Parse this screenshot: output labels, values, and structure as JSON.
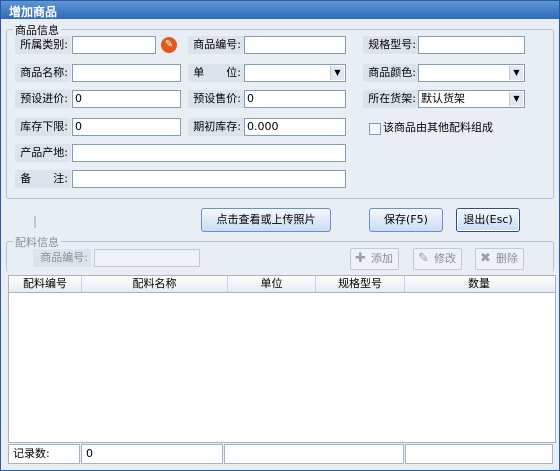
{
  "window": {
    "title": "增加商品"
  },
  "goods_info": {
    "legend": "商品信息",
    "category_label": "所属类别:",
    "category_value": "",
    "code_label": "商品编号:",
    "code_value": "",
    "spec_label": "规格型号:",
    "spec_value": "",
    "name_label": "商品名称:",
    "name_value": "",
    "unit_label": "单　　位:",
    "unit_value": "",
    "color_label": "商品颜色:",
    "color_value": "",
    "purchase_price_label": "预设进价:",
    "purchase_price_value": "0",
    "sale_price_label": "预设售价:",
    "sale_price_value": "0",
    "shelf_label": "所在货架:",
    "shelf_value": "默认货架",
    "stock_min_label": "库存下限:",
    "stock_min_value": "0",
    "initial_stock_label": "期初库存:",
    "initial_stock_value": "0.000",
    "composite_checkbox_label": "该商品由其他配料组成",
    "composite_checked": false,
    "origin_label": "产品产地:",
    "origin_value": "",
    "remark_label": "备　　注:",
    "remark_value": ""
  },
  "actions": {
    "photo_button": "点击查看或上传照片",
    "save_button": "保存(F5)",
    "exit_button": "退出(Esc)"
  },
  "ingredients": {
    "legend": "配料信息",
    "code_label": "商品编号:",
    "code_value": "",
    "add_button": "添加",
    "edit_button": "修改",
    "delete_button": "删除",
    "columns": [
      "配料编号",
      "配料名称",
      "单位",
      "规格型号",
      "数量"
    ],
    "rows": []
  },
  "status": {
    "record_label": "记录数:",
    "record_value": "0"
  },
  "colors": {
    "title_bar": "#2f6ab8",
    "background": "#e9eef5",
    "accent_icon": "#e05a1c"
  }
}
